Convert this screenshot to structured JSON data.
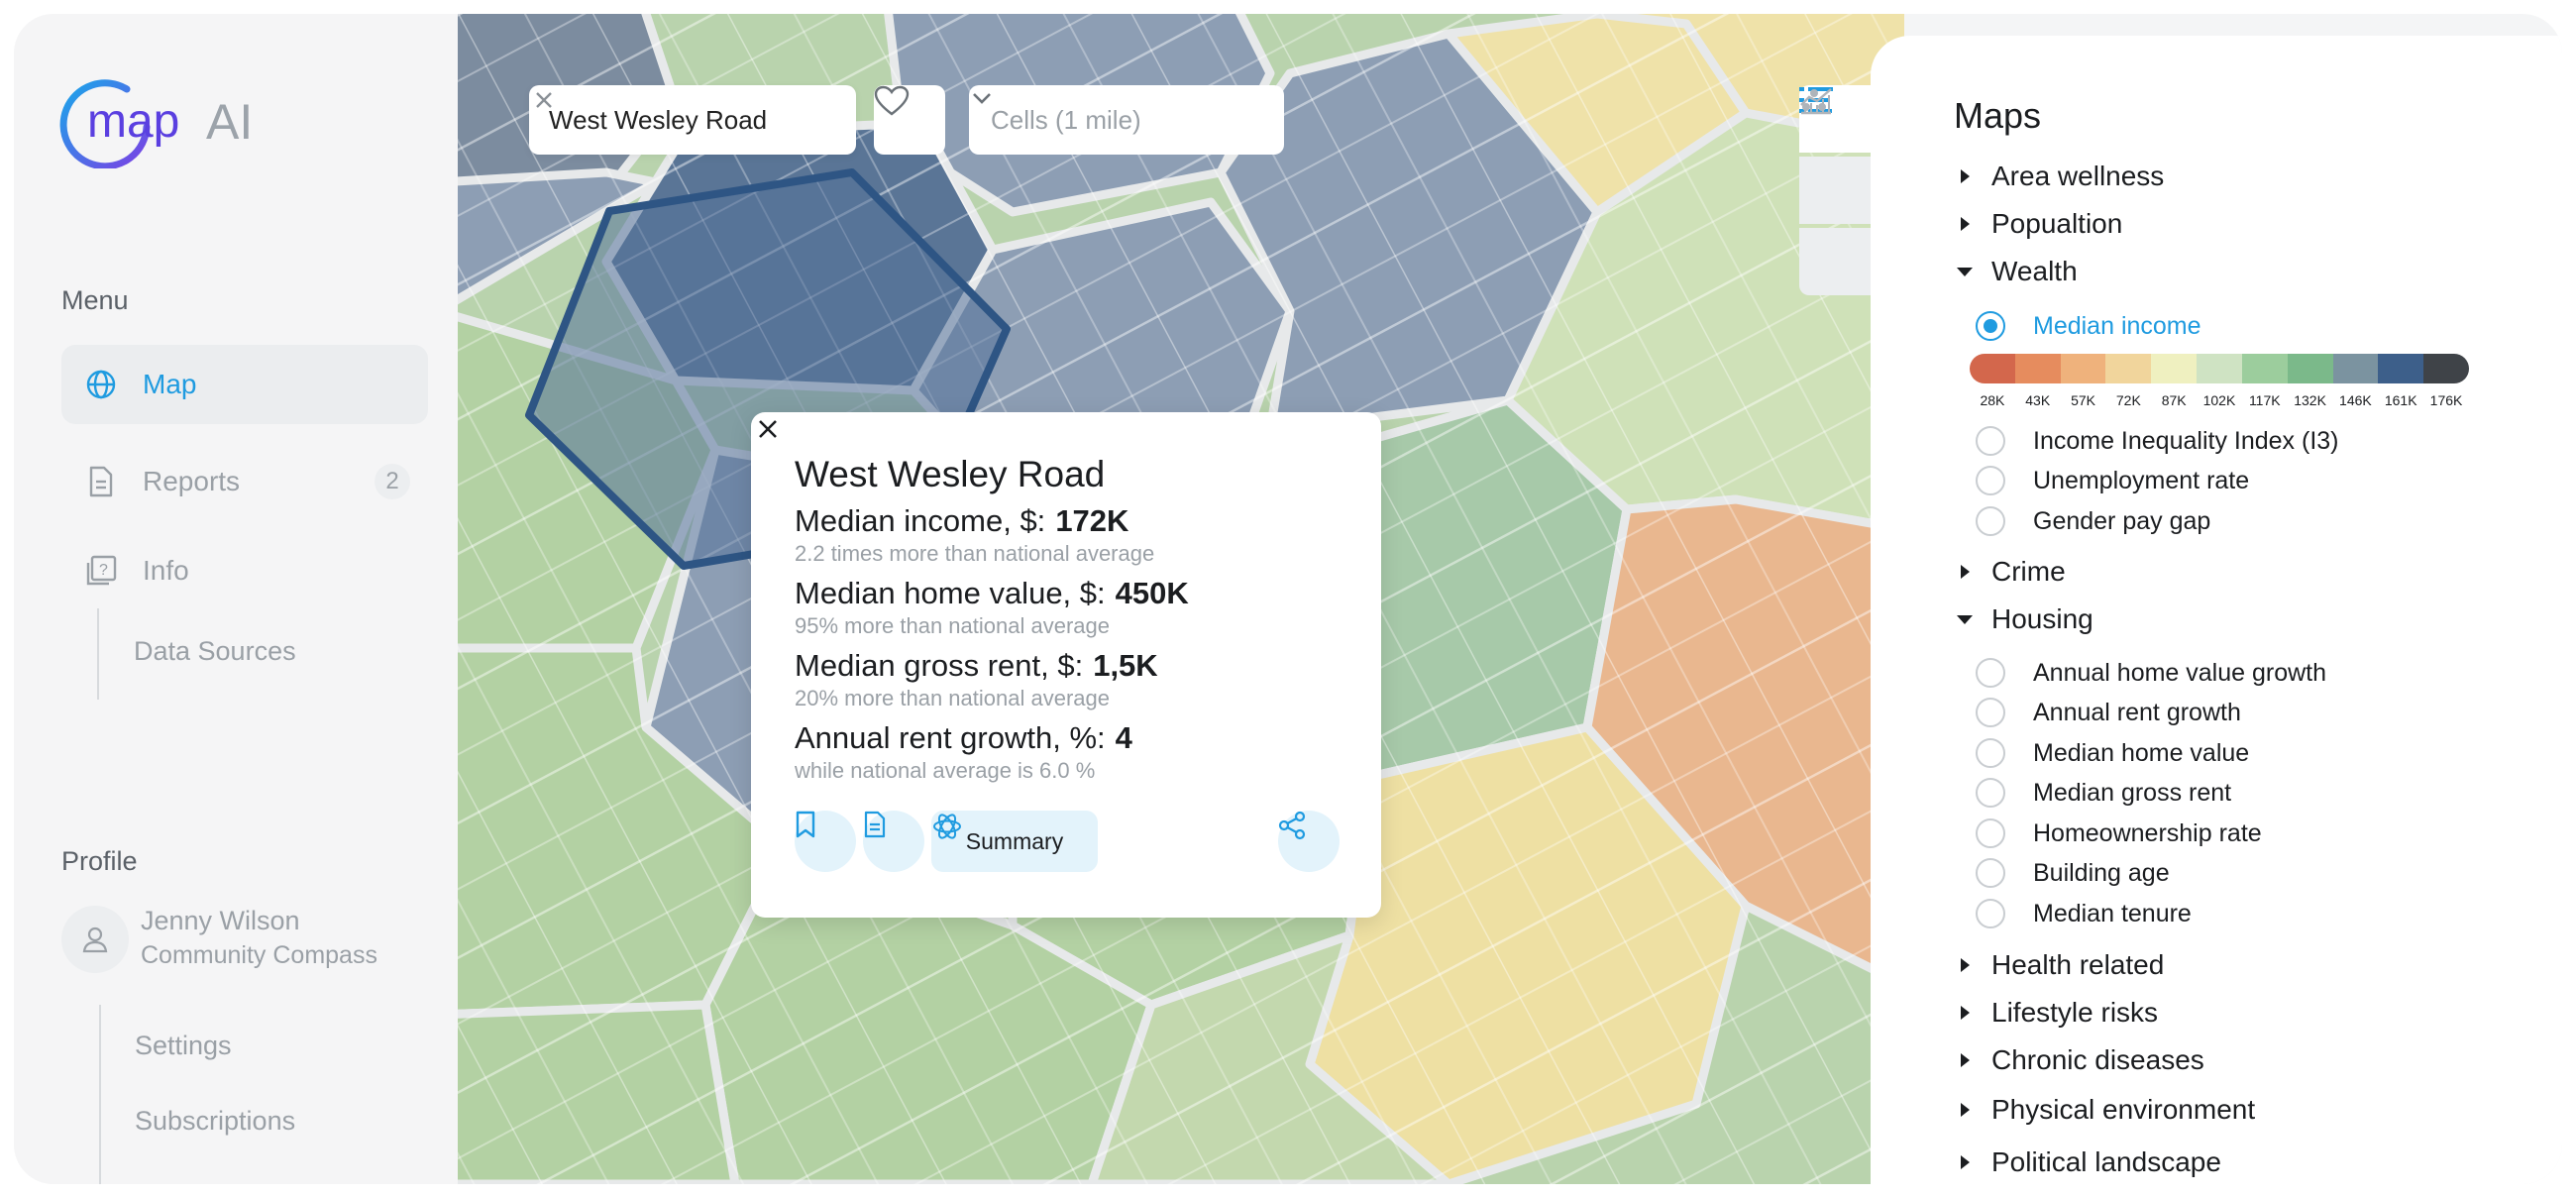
{
  "brand": {
    "logo_map": "map",
    "logo_ai": "AI",
    "accent": "#1f9be0"
  },
  "sidebar": {
    "menu_title": "Menu",
    "items": [
      {
        "label": "Map",
        "icon": "globe-icon",
        "active": true
      },
      {
        "label": "Reports",
        "icon": "document-icon",
        "badge": "2"
      },
      {
        "label": "Info",
        "icon": "info-icon"
      }
    ],
    "info_sub": [
      "Data Sources"
    ],
    "profile_title": "Profile",
    "user_name": "Jenny Wilson",
    "user_org": "Community Compass",
    "profile_sub": [
      "Settings",
      "Subscriptions"
    ]
  },
  "map": {
    "search_value": "West Wesley Road",
    "cells_select": "Cells (1 mile)",
    "tools": [
      "list-icon",
      "chart-icon",
      "scatter-icon"
    ]
  },
  "popup": {
    "title": "West Wesley Road",
    "stats": [
      {
        "label": "Median income, $:",
        "value": "172K",
        "note": "2.2 times more than national average"
      },
      {
        "label": "Median home value, $:",
        "value": "450K",
        "note": "95% more than national average"
      },
      {
        "label": "Median gross rent, $:",
        "value": "1,5K",
        "note": "20% more than national average"
      },
      {
        "label": "Annual rent growth, %:",
        "value": "4",
        "note": "while national average is 6.0 %"
      }
    ],
    "summary_label": "Summary"
  },
  "panel": {
    "title": "Maps",
    "categories": [
      {
        "label": "Area wellness",
        "expanded": false
      },
      {
        "label": "Popualtion",
        "expanded": false
      },
      {
        "label": "Wealth",
        "expanded": true
      },
      {
        "label": "Crime",
        "expanded": false
      },
      {
        "label": "Housing",
        "expanded": true
      },
      {
        "label": "Health related",
        "expanded": false
      },
      {
        "label": "Lifestyle risks",
        "expanded": false
      },
      {
        "label": "Chronic diseases",
        "expanded": false
      },
      {
        "label": "Physical environment",
        "expanded": false
      },
      {
        "label": "Political landscape",
        "expanded": false
      }
    ],
    "wealth_options": [
      {
        "label": "Median income",
        "selected": true
      },
      {
        "label": "Income Inequality Index (I3)"
      },
      {
        "label": "Unemployment rate"
      },
      {
        "label": "Gender pay gap"
      }
    ],
    "housing_options": [
      {
        "label": "Annual home value growth"
      },
      {
        "label": "Annual rent growth"
      },
      {
        "label": "Median home value"
      },
      {
        "label": "Median gross rent"
      },
      {
        "label": "Homeownership rate"
      },
      {
        "label": "Building age"
      },
      {
        "label": "Median tenure"
      }
    ],
    "scale": {
      "labels": [
        "28K",
        "43K",
        "57K",
        "72K",
        "87K",
        "102K",
        "117K",
        "132K",
        "146K",
        "161K",
        "176K"
      ],
      "colors": [
        "#d3674c",
        "#e68c5e",
        "#efb27c",
        "#f1d59c",
        "#eff0c0",
        "#cfe3c3",
        "#9ccd9d",
        "#7bb98a",
        "#7b93a0",
        "#3d5f8a",
        "#3f4348"
      ]
    }
  }
}
